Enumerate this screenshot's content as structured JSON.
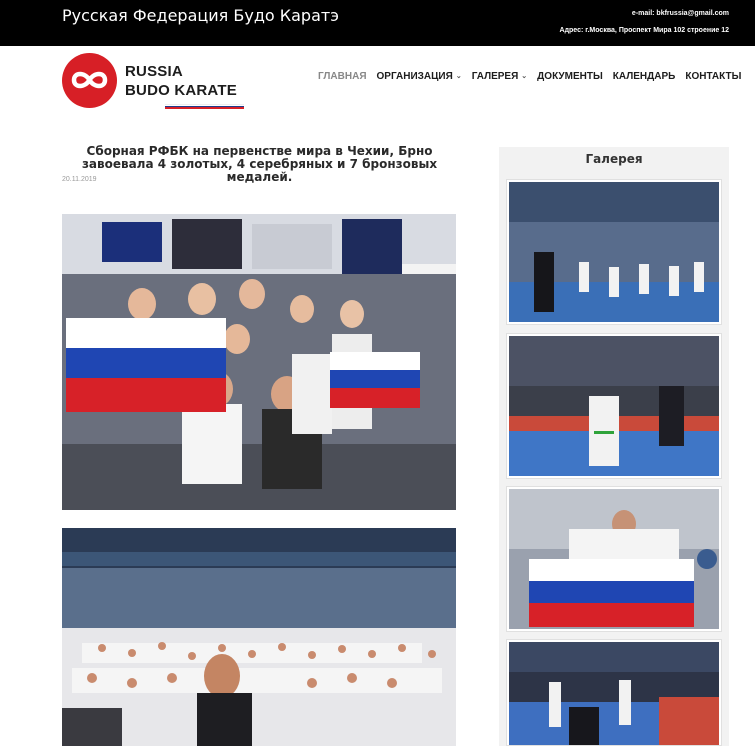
{
  "topbar": {
    "site_title": "Русская Федерация Будо Каратэ",
    "email": "e-mail: bkfrussia@gmail.com",
    "address": "Адрес: г.Москва, Проспект Мира 102 строение 12"
  },
  "logo": {
    "line1": "RUSSIA",
    "line2": "BUDO KARATE",
    "brand_red": "#d71f26",
    "stripe_colors": [
      "#ffffff",
      "#1f3b8c",
      "#d71f26"
    ]
  },
  "nav": {
    "items": [
      {
        "label": "ГЛАВНАЯ",
        "active": true,
        "dropdown": false
      },
      {
        "label": "ОРГАНИЗАЦИЯ",
        "active": false,
        "dropdown": true
      },
      {
        "label": "ГАЛЕРЕЯ",
        "active": false,
        "dropdown": true
      },
      {
        "label": "ДОКУМЕНТЫ",
        "active": false,
        "dropdown": false
      },
      {
        "label": "КАЛЕНДАРЬ",
        "active": false,
        "dropdown": false
      },
      {
        "label": "КОНТАКТЫ",
        "active": false,
        "dropdown": false
      }
    ],
    "dropdown_icon": "chevron-down-icon"
  },
  "article": {
    "title": "Сборная РФБК на первенстве мира в Чехии, Брно завоевала 4 золотых, 4 серебряных и 7 бронзовых медалей.",
    "date": "20.11.2019",
    "photos": [
      "team-with-flags-photo",
      "arena-crowd-photo"
    ]
  },
  "sidebar": {
    "title": "Галерея",
    "thumbnails": [
      "gallery-thumb-1",
      "gallery-thumb-2",
      "gallery-thumb-3",
      "gallery-thumb-4"
    ]
  }
}
